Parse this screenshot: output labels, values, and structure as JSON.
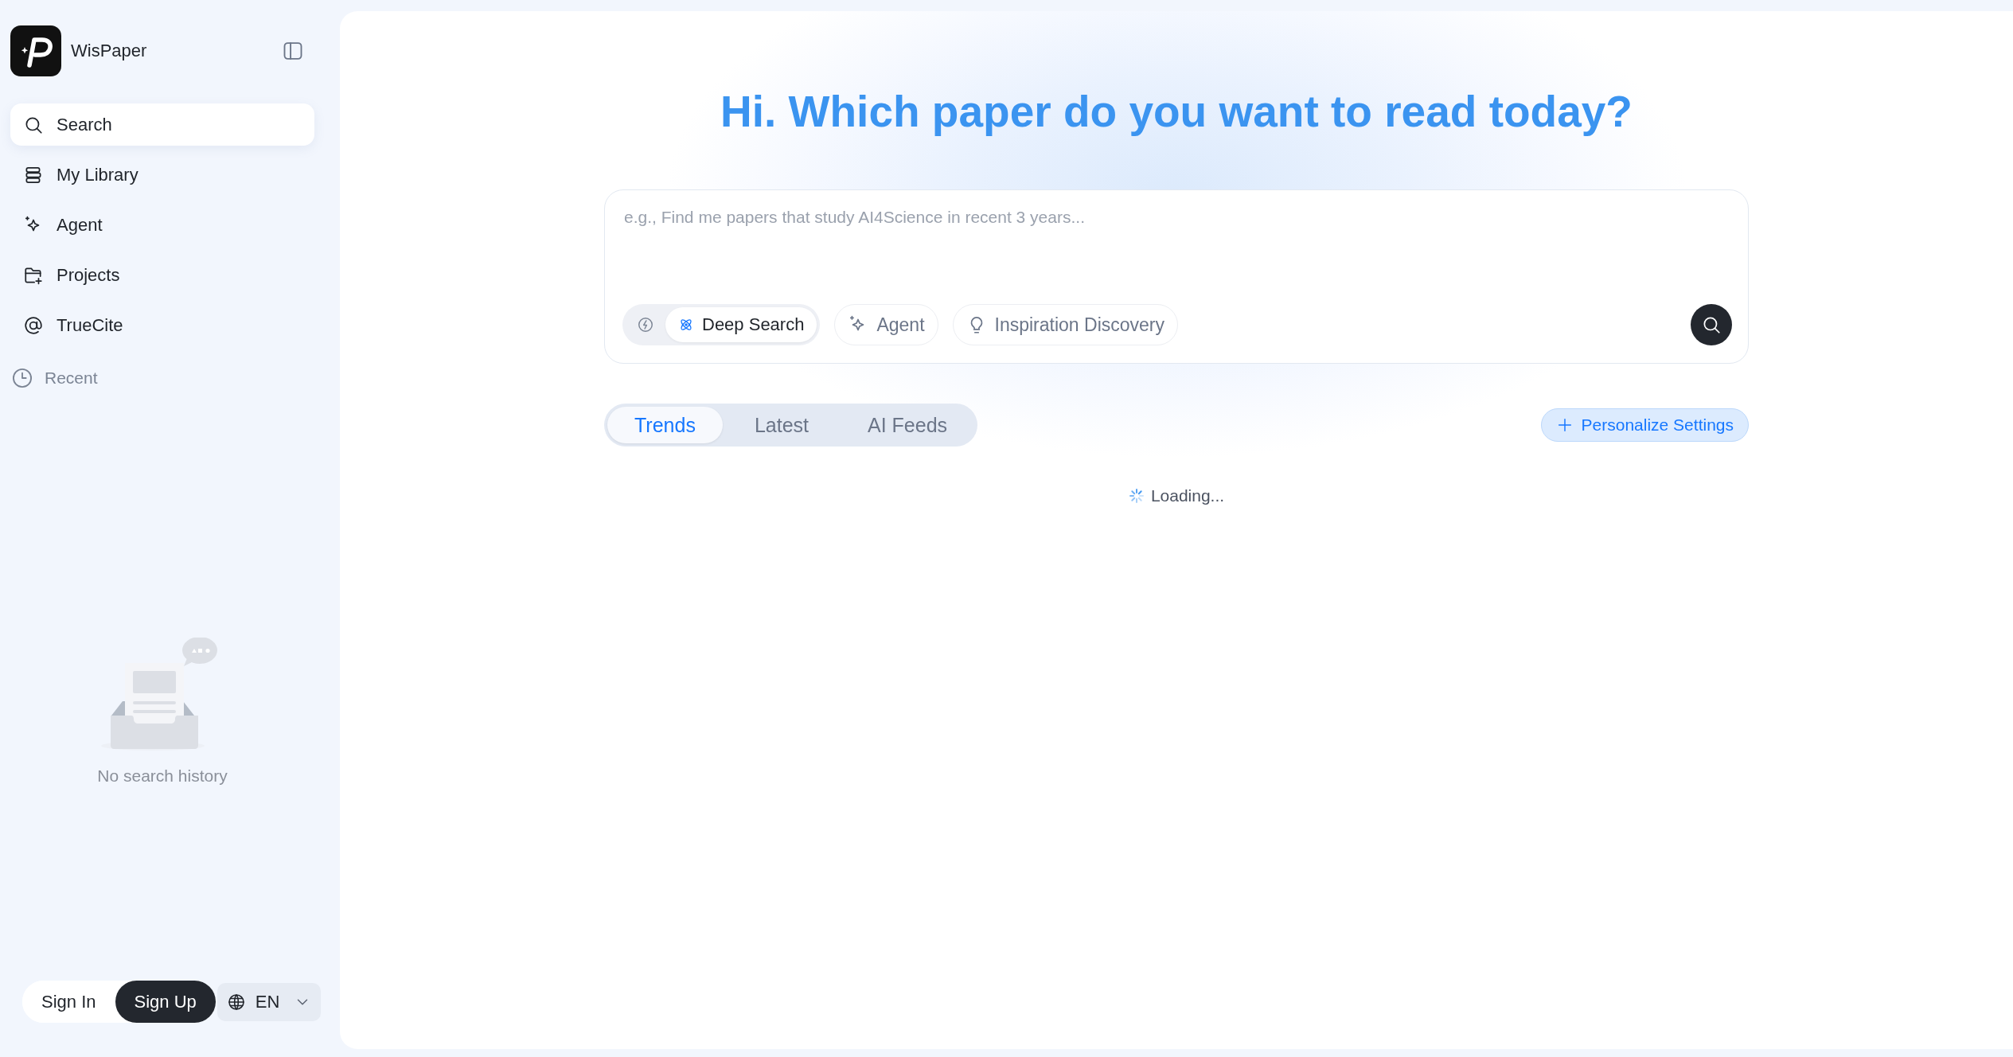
{
  "app": {
    "name": "WisPaper"
  },
  "nav": [
    {
      "label": "Search",
      "selected": true
    },
    {
      "label": "My Library",
      "selected": false
    },
    {
      "label": "Agent",
      "selected": false
    },
    {
      "label": "Projects",
      "selected": false
    },
    {
      "label": "TrueCite",
      "selected": false
    }
  ],
  "recent": {
    "label": "Recent",
    "empty_text": "No search history"
  },
  "auth": {
    "sign_in": "Sign In",
    "sign_up": "Sign Up"
  },
  "language": {
    "value": "EN"
  },
  "headline": "Hi. Which paper do you want to read today?",
  "search": {
    "placeholder": "e.g., Find me papers that study AI4Science in recent 3 years...",
    "modes": [
      {
        "selected": false
      },
      {
        "label": "Deep Search",
        "selected": true
      }
    ],
    "tools": [
      {
        "label": "Agent"
      },
      {
        "label": "Inspiration Discovery"
      }
    ]
  },
  "feed_tabs": [
    {
      "label": "Trends",
      "selected": true
    },
    {
      "label": "Latest",
      "selected": false
    },
    {
      "label": "AI Feeds",
      "selected": false
    }
  ],
  "personalize_button": "Personalize Settings",
  "status": "Loading..."
}
